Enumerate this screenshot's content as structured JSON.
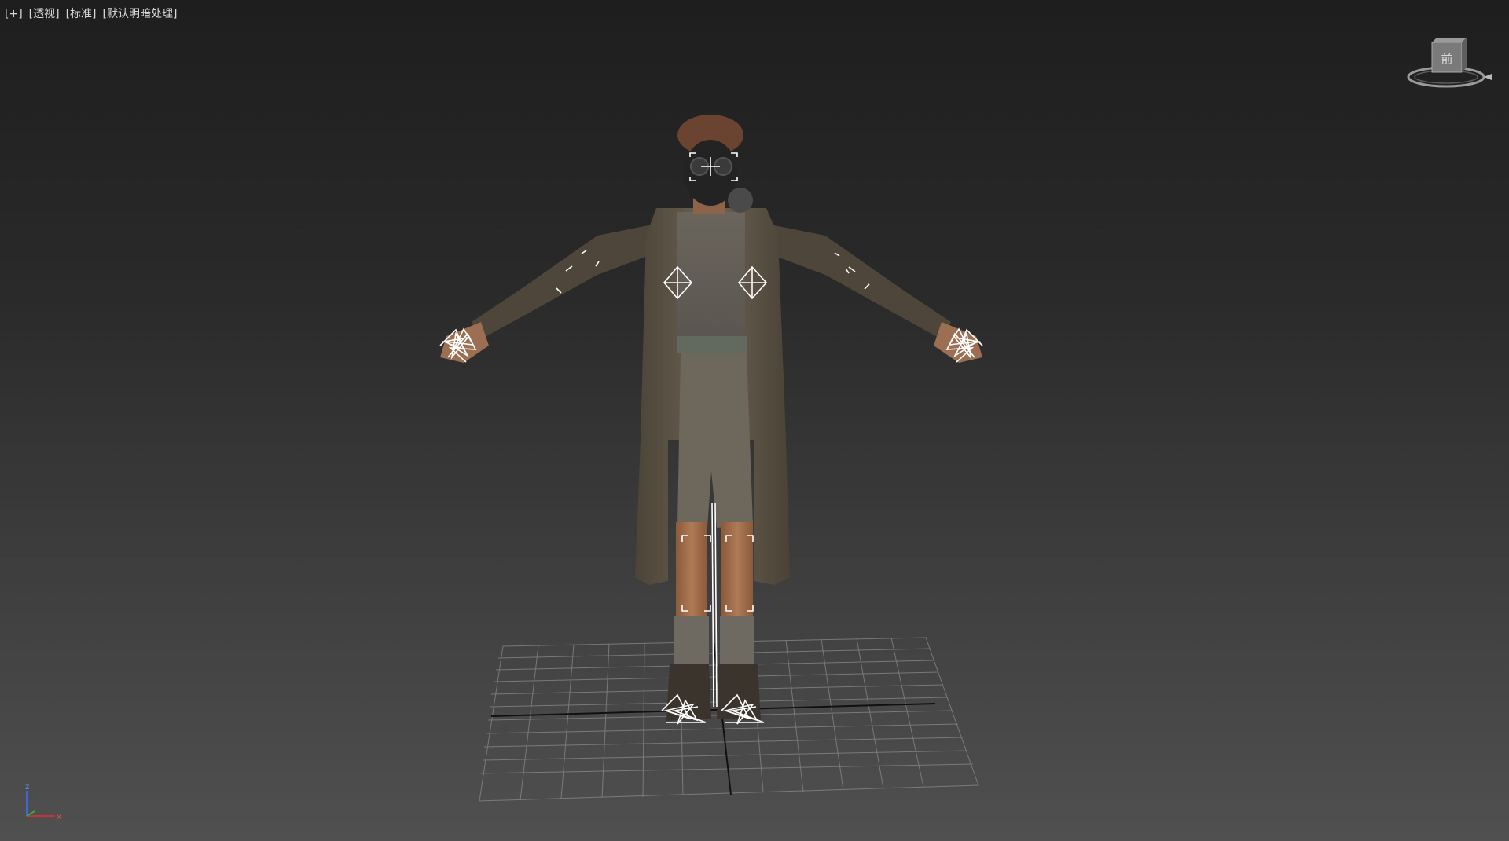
{
  "viewport": {
    "labels": {
      "plus": "[+]",
      "view": "[透视]",
      "shading": "[标准]",
      "lighting": "[默认明暗处理]"
    },
    "viewcube": {
      "face_label": "前"
    },
    "axis": {
      "z": "z",
      "x": "x"
    }
  },
  "colors": {
    "background_top": "#1e1e1e",
    "background_bottom": "#505050",
    "grid": "#8a8a8a",
    "axis_x": "#c83232",
    "axis_y": "#2fa84f",
    "axis_z": "#3f66d8",
    "rig_wire": "#ffffff"
  },
  "icons": {
    "viewcube": "viewcube-icon",
    "axis": "axis-tripod-icon"
  }
}
